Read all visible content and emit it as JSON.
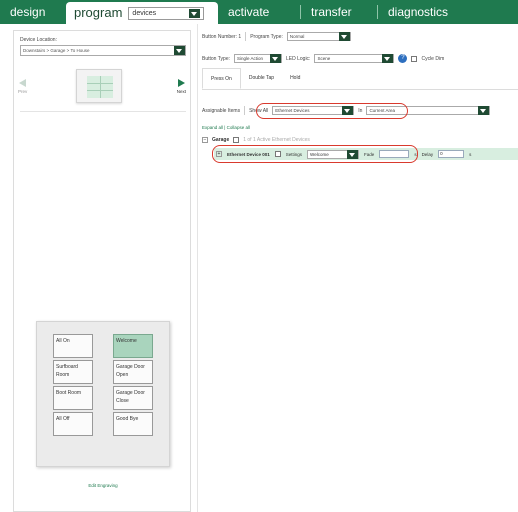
{
  "nav": {
    "design": "design",
    "program": "program",
    "program_select": "devices",
    "activate": "activate",
    "transfer": "transfer",
    "diagnostics": "diagnostics"
  },
  "left": {
    "device_location_label": "Device Location:",
    "device_location_value": "Downstairs > Garage > To House",
    "prev": "Prev",
    "next": "Next",
    "keypad": {
      "left": [
        "All On",
        "Surfboard Room",
        "Boot Room",
        "All Off"
      ],
      "right": [
        "Welcome",
        "Garage Door Open",
        "Garage Door Close",
        "Good Bye"
      ]
    },
    "edit_engraving": "Edit Engraving"
  },
  "right": {
    "button_number": "Button Number: 1",
    "program_type_label": "Program Type:",
    "program_type_value": "Normal",
    "button_type_label": "Button Type:",
    "button_type_value": "Single Action",
    "led_logic_label": "LED Logic:",
    "led_logic_value": "Scene",
    "help": "?",
    "cycle_dim": "Cycle Dim",
    "tabs": [
      "Press On",
      "Double Tap",
      "Hold"
    ],
    "assignable_label": "Assignable Items",
    "show_all": "Show All",
    "show_value": "Ethernet Devices",
    "in_label": "In",
    "in_value": "Current Area",
    "expand_collapse": "Expand all | Collapse all",
    "garage": "Garage",
    "garage_count": "1 of 1 Active Ethernet Devices",
    "device": {
      "name": "Ethernet Device 001",
      "settings_label": "Settings",
      "settings_value": "Welcome",
      "fade_label": "Fade",
      "fade_unit": "s",
      "delay_label": "Delay",
      "delay_value": "0",
      "delay_unit": "s"
    }
  },
  "colors": {
    "brand_green": "#1f7a4f",
    "highlight_green": "#a9d4bd",
    "annotation_red": "#d93a2e"
  }
}
